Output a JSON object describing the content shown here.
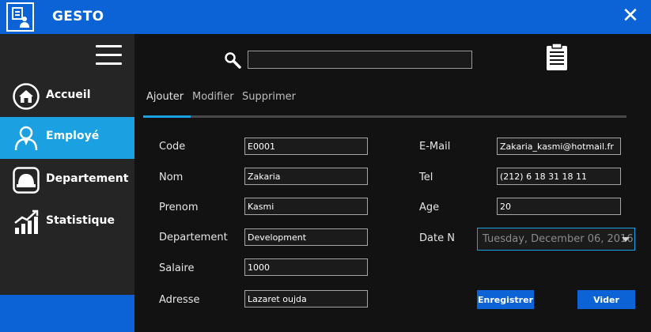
{
  "window": {
    "title": "GESTO",
    "close_glyph": "✕",
    "accent_color": "#0b63d6",
    "active_color": "#1ba1e2"
  },
  "sidebar": {
    "menu_icon": "hamburger-icon",
    "items": [
      {
        "label": "Accueil",
        "icon": "home-icon",
        "active": false
      },
      {
        "label": "Employé",
        "icon": "employee-icon",
        "active": true
      },
      {
        "label": "Departement",
        "icon": "department-helmet-icon",
        "active": false
      },
      {
        "label": "Statistique",
        "icon": "stats-chart-icon",
        "active": false
      }
    ]
  },
  "search": {
    "icon": "search-icon",
    "value": "",
    "placeholder": ""
  },
  "toolbar": {
    "clipboard_icon": "clipboard-icon"
  },
  "tabs": [
    {
      "label": "Ajouter",
      "active": true
    },
    {
      "label": "Modifier",
      "active": false
    },
    {
      "label": "Supprimer",
      "active": false
    }
  ],
  "form": {
    "code": {
      "label": "Code",
      "value": "E0001"
    },
    "nom": {
      "label": "Nom",
      "value": "Zakaria"
    },
    "prenom": {
      "label": "Prenom",
      "value": "Kasmi"
    },
    "departement": {
      "label": "Departement",
      "value": "Development"
    },
    "salaire": {
      "label": "Salaire",
      "value": "1000"
    },
    "adresse": {
      "label": "Adresse",
      "value": "Lazaret oujda"
    },
    "email": {
      "label": "E-Mail",
      "value": "Zakaria_kasmi@hotmail.fr"
    },
    "tel": {
      "label": "Tel",
      "value": "(212) 6 18 31 18 11"
    },
    "age": {
      "label": "Age",
      "value": "20"
    },
    "date_naissance": {
      "label": "Date N",
      "value": "Tuesday,   December  06, 2016"
    }
  },
  "actions": {
    "save_label": "Enregistrer",
    "clear_label": "Vider"
  }
}
